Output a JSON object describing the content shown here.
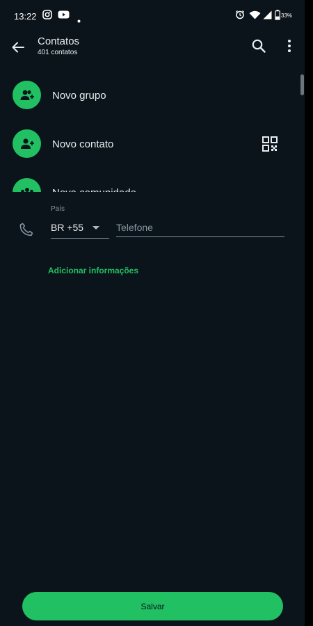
{
  "status_bar": {
    "time": "13:22",
    "battery": "33%",
    "icons": [
      "instagram-icon",
      "youtube-icon",
      "dot-icon",
      "alarm-icon",
      "wifi-icon",
      "signal-icon",
      "battery-icon"
    ]
  },
  "app_bar": {
    "title": "Contatos",
    "subtitle": "401 contatos",
    "icons": [
      "back-arrow-icon",
      "search-icon",
      "more-vert-icon"
    ]
  },
  "list": {
    "items": [
      {
        "label": "Novo grupo",
        "icon": "group-add-icon"
      },
      {
        "label": "Novo contato",
        "icon": "person-add-icon",
        "trailing_icon": "qr-code-icon"
      },
      {
        "label": "Nova comunidade",
        "icon": "community-icon"
      }
    ]
  },
  "form": {
    "country_label": "País",
    "country_value": "BR +55",
    "phone_placeholder": "Telefone",
    "phone_value": "",
    "add_info_label": "Adicionar informações",
    "save_label": "Salvar"
  },
  "colors": {
    "background": "#0b141a",
    "accent": "#21c063",
    "text_primary": "#e9edef",
    "text_secondary": "#8696a0"
  }
}
